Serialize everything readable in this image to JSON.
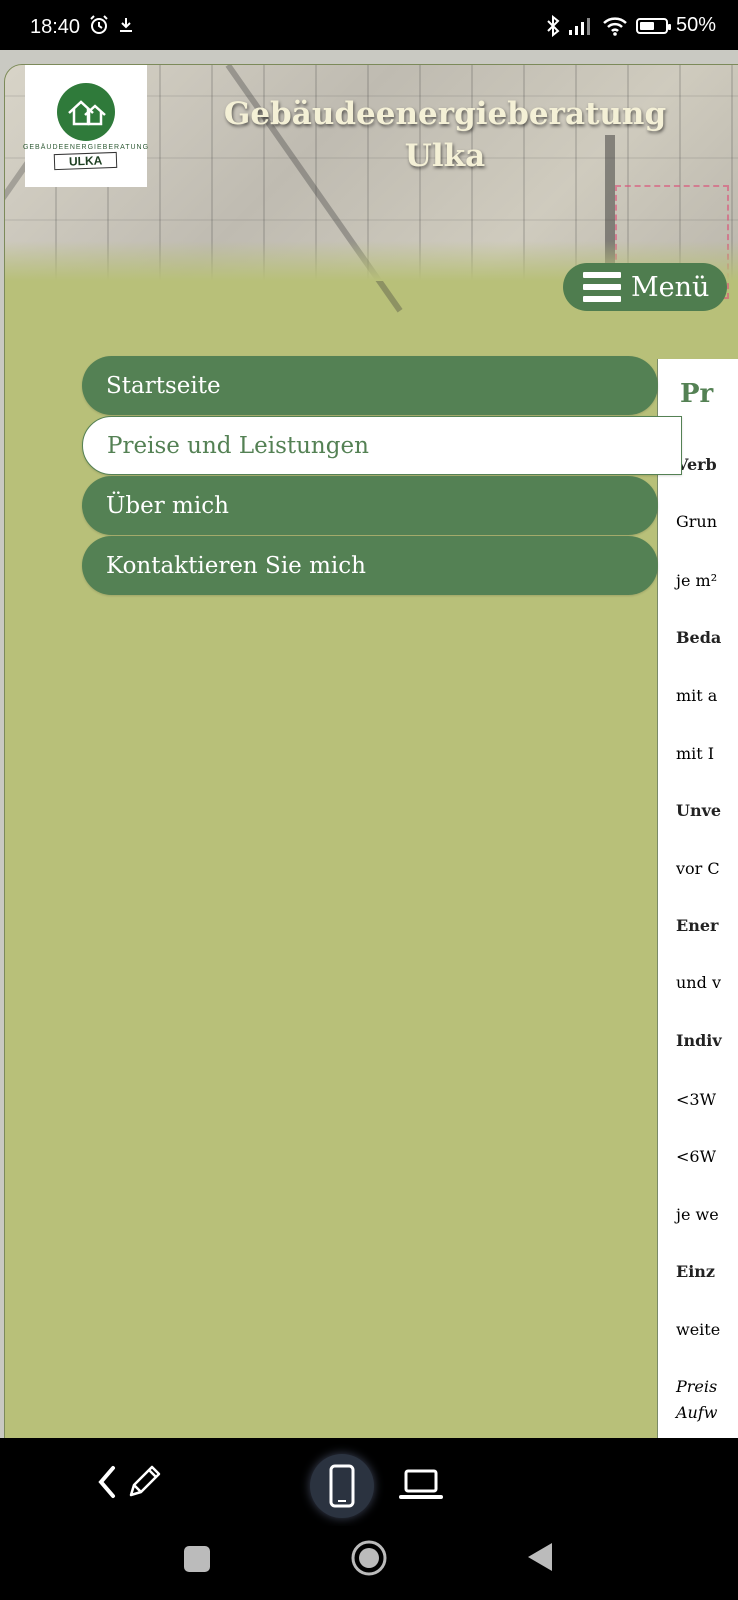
{
  "status_bar": {
    "time": "18:40",
    "battery_text": "50%",
    "battery_level": 0.5
  },
  "header": {
    "logo_text": "GEBÄUDEENERGIEBERATUNG",
    "logo_badge": "ULKA",
    "title_line1": "Gebäudeenergieberatung",
    "title_line2": "Ulka",
    "menu_label": "Menü"
  },
  "nav": {
    "items": [
      {
        "label": "Startseite",
        "active": false
      },
      {
        "label": "Preise und Leistungen",
        "active": true
      },
      {
        "label": "Über mich",
        "active": false
      },
      {
        "label": "Kontaktieren Sie mich",
        "active": false
      }
    ]
  },
  "content": {
    "title": "Pr",
    "lines": [
      {
        "text": "Verb",
        "style": "bold"
      },
      {
        "text": "Grun",
        "style": "normal"
      },
      {
        "text": "je m²",
        "style": "normal"
      },
      {
        "text": "Beda",
        "style": "bold"
      },
      {
        "text": "mit a",
        "style": "normal"
      },
      {
        "text": "mit I",
        "style": "normal"
      },
      {
        "text": "Unve",
        "style": "bold"
      },
      {
        "text": "vor C",
        "style": "normal"
      },
      {
        "text": "Ener",
        "style": "bold"
      },
      {
        "text": "und v",
        "style": "normal"
      },
      {
        "text": "Indiv",
        "style": "bold"
      },
      {
        "text": "<3W",
        "style": "normal"
      },
      {
        "text": "<6W",
        "style": "normal"
      },
      {
        "text": "je we",
        "style": "normal"
      },
      {
        "text": "Einz",
        "style": "bold"
      },
      {
        "text": "weite",
        "style": "normal"
      },
      {
        "text": "Preis",
        "style": "italic"
      },
      {
        "text": "Aufw",
        "style": "italic"
      }
    ]
  },
  "toolbar": {
    "back_icon": "chevron-left-icon",
    "edit_icon": "pencil-icon",
    "mobile_icon": "smartphone-icon",
    "desktop_icon": "laptop-icon"
  },
  "colors": {
    "nav_green": "#548154",
    "page_bg": "#b8c079",
    "title_text": "#f4f0d6"
  }
}
